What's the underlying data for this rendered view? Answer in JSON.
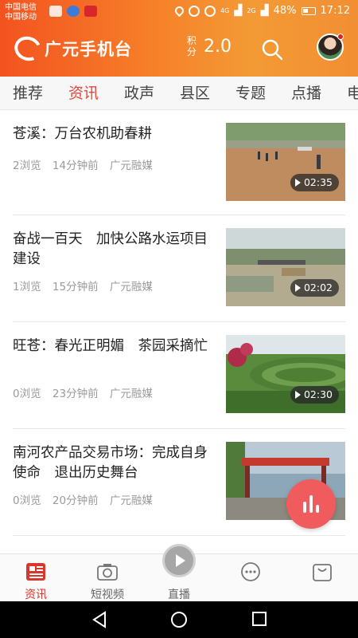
{
  "status_bar": {
    "carrier_1": "中国电信",
    "carrier_2": "中国移动",
    "battery_percent": "48%",
    "time": "17:12",
    "net_4g": "4G",
    "net_2g": "2G"
  },
  "header": {
    "app_name": "广元手机台",
    "points_label": "积分",
    "points_value": "2.0",
    "icons": [
      "logo-icon",
      "search-icon",
      "avatar"
    ]
  },
  "tabs": [
    {
      "label": "推荐",
      "active": false
    },
    {
      "label": "资讯",
      "active": true
    },
    {
      "label": "政声",
      "active": false
    },
    {
      "label": "县区",
      "active": false
    },
    {
      "label": "专题",
      "active": false
    },
    {
      "label": "点播",
      "active": false
    },
    {
      "label": "电",
      "active": false
    }
  ],
  "news": [
    {
      "title": "苍溪：万台农机助春耕",
      "views": "2浏览",
      "time": "14分钟前",
      "source": "广元融媒",
      "duration": "02:35"
    },
    {
      "title": "奋战一百天　加快公路水运项目建设",
      "views": "1浏览",
      "time": "15分钟前",
      "source": "广元融媒",
      "duration": "02:02"
    },
    {
      "title": "旺苍：春光正明媚　茶园采摘忙",
      "views": "0浏览",
      "time": "23分钟前",
      "source": "广元融媒",
      "duration": "02:30"
    },
    {
      "title": "南河农产品交易市场：完成自身使命　退出历史舞台",
      "views": "0浏览",
      "time": "20分钟前",
      "source": "广元融媒",
      "duration": ""
    }
  ],
  "bottom_nav": [
    {
      "label": "资讯",
      "icon": "news-icon",
      "active": true
    },
    {
      "label": "短视频",
      "icon": "camera-icon",
      "active": false
    },
    {
      "label": "直播",
      "icon": "play-icon",
      "active": false
    },
    {
      "label": "",
      "icon": "chat-icon",
      "active": false
    },
    {
      "label": "",
      "icon": "shopping-bag-icon",
      "active": false
    }
  ],
  "colors": {
    "brand_orange": "#f3531f",
    "active_red": "#e1473b",
    "fab_red": "#f05b5e"
  }
}
